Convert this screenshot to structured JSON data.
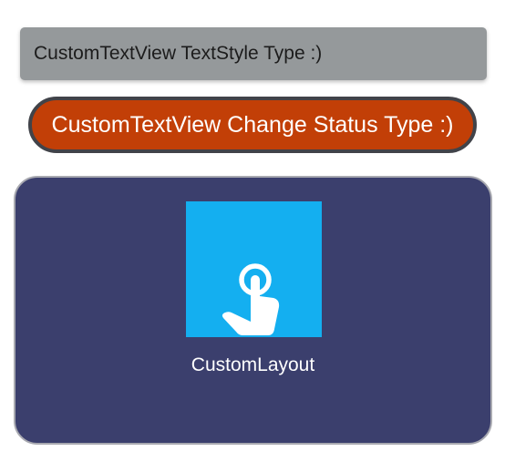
{
  "text_style_view": {
    "label": "CustomTextView TextStyle Type :)",
    "background": "#95999b"
  },
  "status_view": {
    "label": "CustomTextView Change Status Type :)",
    "background": "#c23f07",
    "border_color": "#414349"
  },
  "custom_layout": {
    "label": "CustomLayout",
    "background": "#3b3f6d",
    "icon": "touch-app-icon",
    "icon_background": "#14aff0"
  }
}
